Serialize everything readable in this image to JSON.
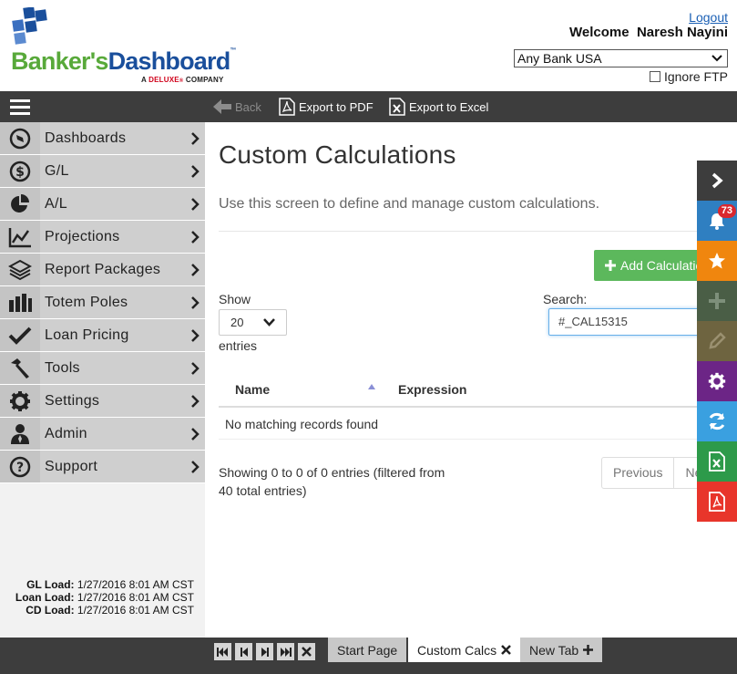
{
  "header": {
    "logo_text_1": "Banker's",
    "logo_text_2": "Dashboard",
    "logo_tm": "™",
    "tagline_prefix": "A",
    "tagline_brand": "DELUXE",
    "tagline_suffix": "COMPANY",
    "logout_label": "Logout",
    "welcome_text": "Welcome  Naresh Nayini",
    "bank_selected": "Any Bank USA",
    "ignore_ftp_label": "Ignore FTP",
    "colors": {
      "green": "#58a93a",
      "blue": "#1a4f9c"
    }
  },
  "toolbar": {
    "back_label": "Back",
    "export_pdf_label": "Export to PDF",
    "export_excel_label": "Export to Excel"
  },
  "sidebar": {
    "items": [
      {
        "label": "Dashboards",
        "icon": "compass-icon"
      },
      {
        "label": "G/L",
        "icon": "dollar-icon"
      },
      {
        "label": "A/L",
        "icon": "pie-chart-icon"
      },
      {
        "label": "Projections",
        "icon": "line-chart-icon"
      },
      {
        "label": "Report Packages",
        "icon": "layers-icon"
      },
      {
        "label": "Totem Poles",
        "icon": "bar-chart-icon"
      },
      {
        "label": "Loan Pricing",
        "icon": "checkmark-icon"
      },
      {
        "label": "Tools",
        "icon": "hammer-icon"
      },
      {
        "label": "Settings",
        "icon": "gear-icon"
      },
      {
        "label": "Admin",
        "icon": "user-icon"
      },
      {
        "label": "Support",
        "icon": "question-icon"
      }
    ],
    "load_info": [
      {
        "label": "GL Load:",
        "value": "1/27/2016 8:01 AM CST"
      },
      {
        "label": "Loan Load:",
        "value": "1/27/2016 8:01 AM CST"
      },
      {
        "label": "CD Load:",
        "value": "1/27/2016 8:01 AM CST"
      }
    ]
  },
  "main": {
    "title": "Custom Calculations",
    "description": "Use this screen to define and manage custom calculations.",
    "add_button_label": "Add Calculation",
    "show_label": "Show",
    "entries_value": "20",
    "entries_label": "entries",
    "search_label": "Search:",
    "search_value": "#_CAL15315",
    "columns": [
      "Name",
      "Expression"
    ],
    "empty_message": "No matching records found",
    "info_text": "Showing 0 to 0 of 0 entries (filtered from 40 total entries)",
    "pagination": {
      "previous": "Previous",
      "next": "Next"
    }
  },
  "rail": {
    "notification_count": "73",
    "buttons": [
      {
        "name": "collapse-rail-button",
        "icon": "chevron-right-icon",
        "color": "#3d3d3d"
      },
      {
        "name": "notifications-button",
        "icon": "bell-icon",
        "color": "#2f7fc1"
      },
      {
        "name": "favorites-button",
        "icon": "star-icon",
        "color": "#f0860e"
      },
      {
        "name": "add-favorite-button",
        "icon": "plus-icon",
        "color": "#4a5e46"
      },
      {
        "name": "edit-button",
        "icon": "pencil-icon",
        "color": "#6e6440"
      },
      {
        "name": "settings-button",
        "icon": "gear-icon",
        "color": "#6c2586"
      },
      {
        "name": "refresh-button",
        "icon": "refresh-icon",
        "color": "#3aa0e0"
      },
      {
        "name": "excel-button",
        "icon": "excel-icon",
        "color": "#2d9a4a"
      },
      {
        "name": "pdf-button",
        "icon": "pdf-icon",
        "color": "#e8352b"
      }
    ]
  },
  "tabs": {
    "items": [
      {
        "label": "Start Page",
        "active": false
      },
      {
        "label": "Custom Calcs",
        "active": true
      },
      {
        "label": "New Tab",
        "active": false
      }
    ]
  }
}
